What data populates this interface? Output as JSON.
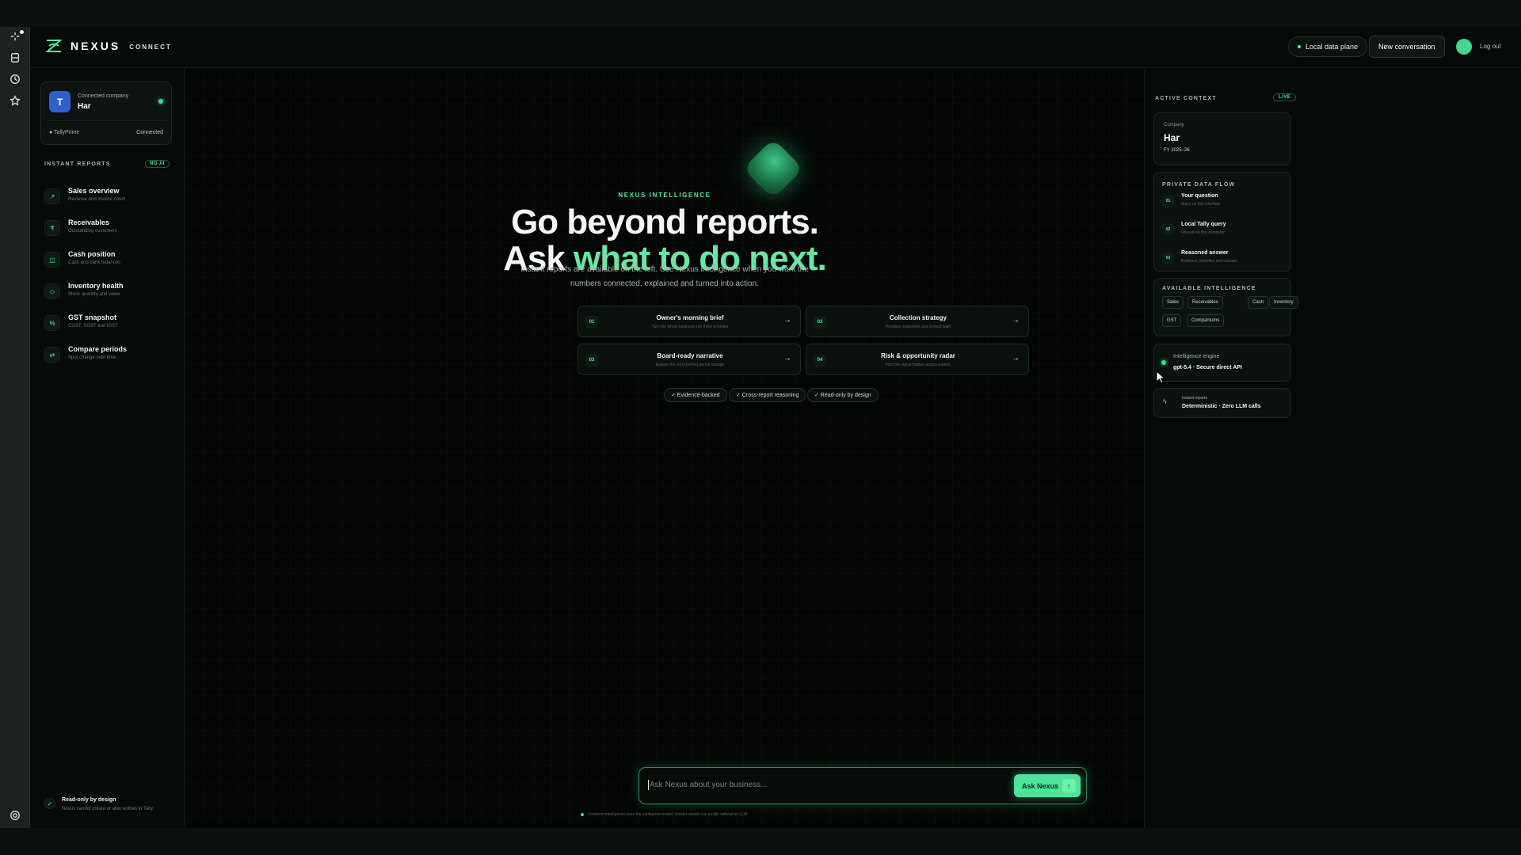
{
  "brand": {
    "name": "NEXUS",
    "sub": "CONNECT"
  },
  "header": {
    "data_plane": "Local data plane",
    "new_conversation": "New conversation",
    "logout": "Log out"
  },
  "sidebar": {
    "company": {
      "label": "Connected company",
      "name": "Har",
      "initial": "T",
      "source": "TallyPrime",
      "status": "Connected"
    },
    "reports_title": "INSTANT REPORTS",
    "reports_badge": "NO AI",
    "reports": [
      {
        "title": "Sales overview",
        "sub": "Revenue and invoice count",
        "icon": "↗"
      },
      {
        "title": "Receivables",
        "sub": "Outstanding customers",
        "icon": "₹"
      },
      {
        "title": "Cash position",
        "sub": "Cash and bank balances",
        "icon": "◫"
      },
      {
        "title": "Inventory health",
        "sub": "Stock quantity and value",
        "icon": "◇"
      },
      {
        "title": "GST snapshot",
        "sub": "CGST, SGST and IGST",
        "icon": "%"
      },
      {
        "title": "Compare periods",
        "sub": "Spot change over time",
        "icon": "⇄"
      }
    ],
    "readonly": {
      "title": "Read-only by design",
      "sub": "Nexus cannot create or alter entries in Tally."
    }
  },
  "hero": {
    "kicker": "NEXUS INTELLIGENCE",
    "line1": "Go beyond reports.",
    "line2a": "Ask ",
    "line2b": "what to do next.",
    "sub1": "Instant reports are available on the left. Use Nexus intelligence when you want the",
    "sub2": "numbers connected, explained and turned into action."
  },
  "actions": [
    {
      "num": "01",
      "title": "Owner's morning brief",
      "sub": "Turn the whole business into three priorities"
    },
    {
      "num": "02",
      "title": "Collection strategy",
      "sub": "Prioritise customers and protect cash"
    },
    {
      "num": "03",
      "title": "Board-ready narrative",
      "sub": "Explain the story behind period change"
    },
    {
      "num": "04",
      "title": "Risk & opportunity radar",
      "sub": "Find the signal hidden across reports"
    }
  ],
  "chips": [
    "✓ Evidence-backed",
    "✓ Cross-report reasoning",
    "✓ Read-only by design"
  ],
  "ask": {
    "placeholder": "Ask Nexus about your business...",
    "button": "Ask Nexus",
    "footnote": "Freeform intelligence uses the configured model. Instant reports run locally without an LLM."
  },
  "context": {
    "title": "ACTIVE CONTEXT",
    "live": "LIVE",
    "company_label": "Company",
    "company": "Har",
    "fy": "FY 2025–26",
    "flow_title": "PRIVATE DATA FLOW",
    "flow": [
      {
        "num": "01",
        "title": "Your question",
        "sub": "Stays on this interface"
      },
      {
        "num": "02",
        "title": "Local Tally query",
        "sub": "Filtered on this computer"
      },
      {
        "num": "03",
        "title": "Reasoned answer",
        "sub": "Evidence, priorities and caveats"
      }
    ],
    "intel_title": "AVAILABLE INTELLIGENCE",
    "tags": [
      "Sales",
      "Receivables",
      "Cash",
      "Inventory",
      "GST",
      "Comparisons"
    ],
    "engine_label": "Intelligence engine",
    "engine": "gpt-5.4 · Secure direct API",
    "instant_label": "Instant reports",
    "instant": "Deterministic · Zero LLM calls"
  },
  "colors": {
    "accent": "#5be6a0",
    "background": "#050806"
  }
}
